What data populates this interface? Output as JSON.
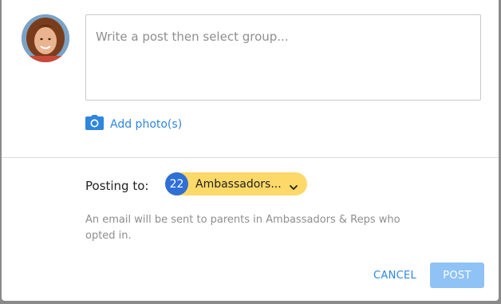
{
  "composer": {
    "placeholder": "Write a post then select group...",
    "value": ""
  },
  "attachments": {
    "add_photo_label": "Add photo(s)",
    "icon": "camera-icon"
  },
  "posting": {
    "label": "Posting to:",
    "group_count": "22",
    "group_name": "Ambassadors...",
    "note": "An email will be sent to parents in Ambassadors & Reps who opted in."
  },
  "actions": {
    "cancel_label": "CANCEL",
    "post_label": "POST"
  },
  "colors": {
    "accent": "#2e86de",
    "pill": "#fcd969",
    "badge": "#2f6fd6",
    "post_disabled": "#8fc2f5"
  }
}
